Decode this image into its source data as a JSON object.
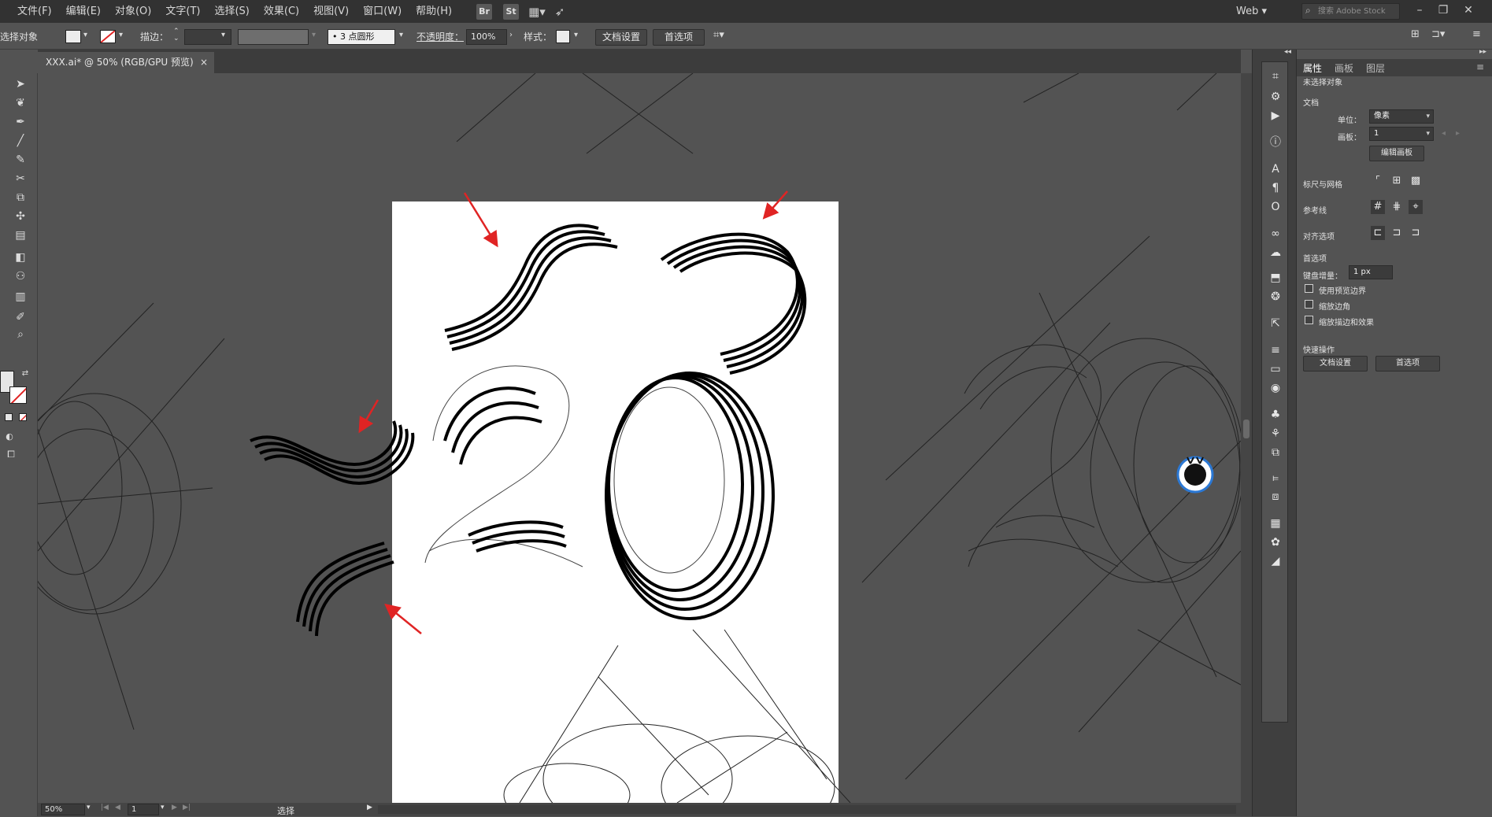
{
  "menubar": {
    "items": [
      "文件(F)",
      "编辑(E)",
      "对象(O)",
      "文字(T)",
      "选择(S)",
      "效果(C)",
      "视图(V)",
      "窗口(W)",
      "帮助(H)"
    ],
    "app_icons": [
      "Br",
      "St"
    ],
    "workspace": "Web",
    "stock_placeholder": "搜索 Adobe Stock"
  },
  "controlbar": {
    "selection_label": "选择对象",
    "stroke_label": "描边：",
    "brush_value": "3 点圆形",
    "opacity_label": "不透明度：",
    "opacity_value": "100%",
    "style_label": "样式：",
    "doc_setup_button": "文档设置",
    "prefs_button": "首选项"
  },
  "tab": {
    "title": "XXX.ai* @ 50% (RGB/GPU 预览)",
    "close": "×"
  },
  "status": {
    "zoom": "50%",
    "artboard_num": "1",
    "mode": "选择"
  },
  "properties": {
    "tabs": [
      "属性",
      "画板",
      "图层"
    ],
    "no_selection": "未选择对象",
    "doc_section": "文档",
    "unit_label": "单位：",
    "unit_value": "像素",
    "artboard_label": "画板：",
    "artboard_value": "1",
    "edit_artboard_button": "编辑画板",
    "rulers_grids": "标尺与网格",
    "guides": "参考线",
    "snap_options": "对齐选项",
    "prefs_section": "首选项",
    "keyboard_increment_label": "键盘增量：",
    "keyboard_increment_value": "1 px",
    "checkbox_preview_bounds": "使用预览边界",
    "checkbox_scale_corners": "缩放边角",
    "checkbox_scale_strokes": "缩放描边和效果",
    "quick_actions": "快速操作",
    "doc_setup_button": "文档设置",
    "prefs_button": "首选项"
  },
  "watermark_icon": "deer-logo-icon",
  "colors": {
    "arrow": "#e02424",
    "artboard": "#ffffff",
    "ui_dark": "#323232",
    "ui_mid": "#535353"
  }
}
